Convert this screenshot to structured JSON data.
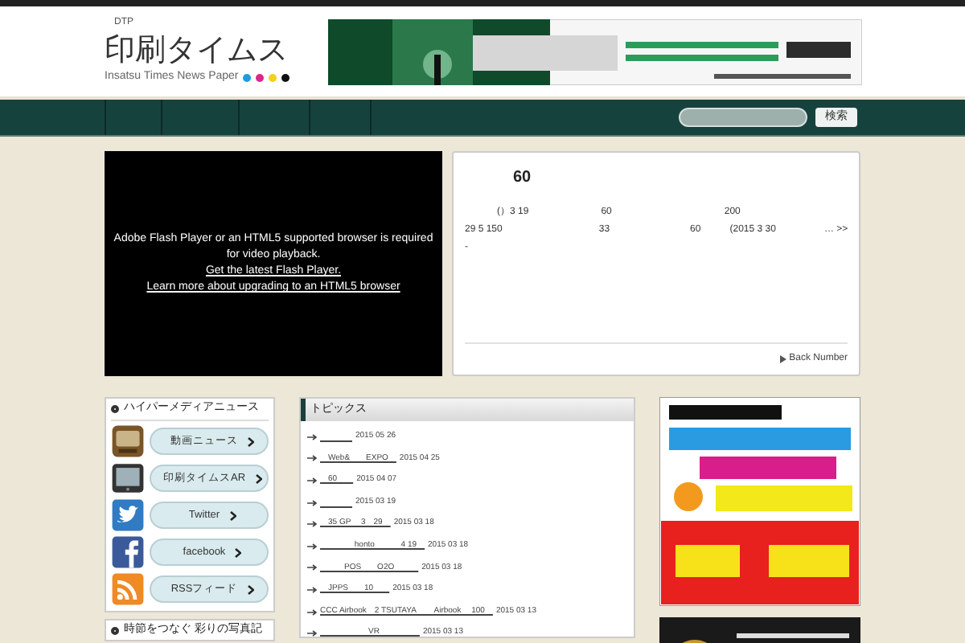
{
  "header": {
    "tag": "DTP",
    "logo": "印刷タイムス",
    "subtitle": "Insatsu Times News Paper",
    "dots": [
      {
        "color": "#1e9be0"
      },
      {
        "color": "#e0248a"
      },
      {
        "color": "#f2d21a"
      },
      {
        "color": "#111111"
      }
    ]
  },
  "nav": {
    "search_button": "検索"
  },
  "video": {
    "message": "Adobe Flash Player or an HTML5 supported browser is required for video playback.",
    "links": [
      "Get the latest Flash Player.",
      "Learn more about upgrading to an HTML5 browser"
    ]
  },
  "news": {
    "title": "60",
    "lines": [
      [
        "(",
        "）3 19",
        "60",
        "200"
      ],
      [
        "29 5  150",
        "33",
        "60",
        "(2015 3 30",
        "… >>"
      ],
      [
        "-"
      ]
    ],
    "back": "Back Number"
  },
  "sidebar": {
    "title": "ハイパーメディアニュース",
    "items": [
      {
        "label": "動画ニュース",
        "kind": "tv"
      },
      {
        "label": "印刷タイムスAR",
        "kind": "tablet"
      },
      {
        "label": "Twitter",
        "kind": "twitter"
      },
      {
        "label": "facebook",
        "kind": "facebook"
      },
      {
        "label": "RSSフィード",
        "kind": "rss"
      }
    ],
    "next_title": "時節をつなぐ 彩りの写真記"
  },
  "topics": {
    "title": "トピックス",
    "items": [
      {
        "date": "2015 05 26"
      },
      {
        "link": "　Web&　　EXPO　",
        "date": "2015 04 25"
      },
      {
        "link": "　60　　",
        "date": "2015 04 07"
      },
      {
        "date": "2015 03 19"
      },
      {
        "link": "　35 GP　 3　29　",
        "date": "2015 03 18"
      },
      {
        "link": "　　　　 honto　　　 4 19　",
        "date": "2015 03 18"
      },
      {
        "link": "　　　POS　　O2O　　　",
        "date": "2015 03 18"
      },
      {
        "link": "　JPPS　　10　　",
        "date": "2015 03 18"
      },
      {
        "link": "CCC Airbook　2 TSUTAYA　　 Airbook　 100　",
        "date": "2015 03 13"
      },
      {
        "link": "　　　　　　VR　　　　　",
        "date": "2015 03 13"
      }
    ]
  }
}
